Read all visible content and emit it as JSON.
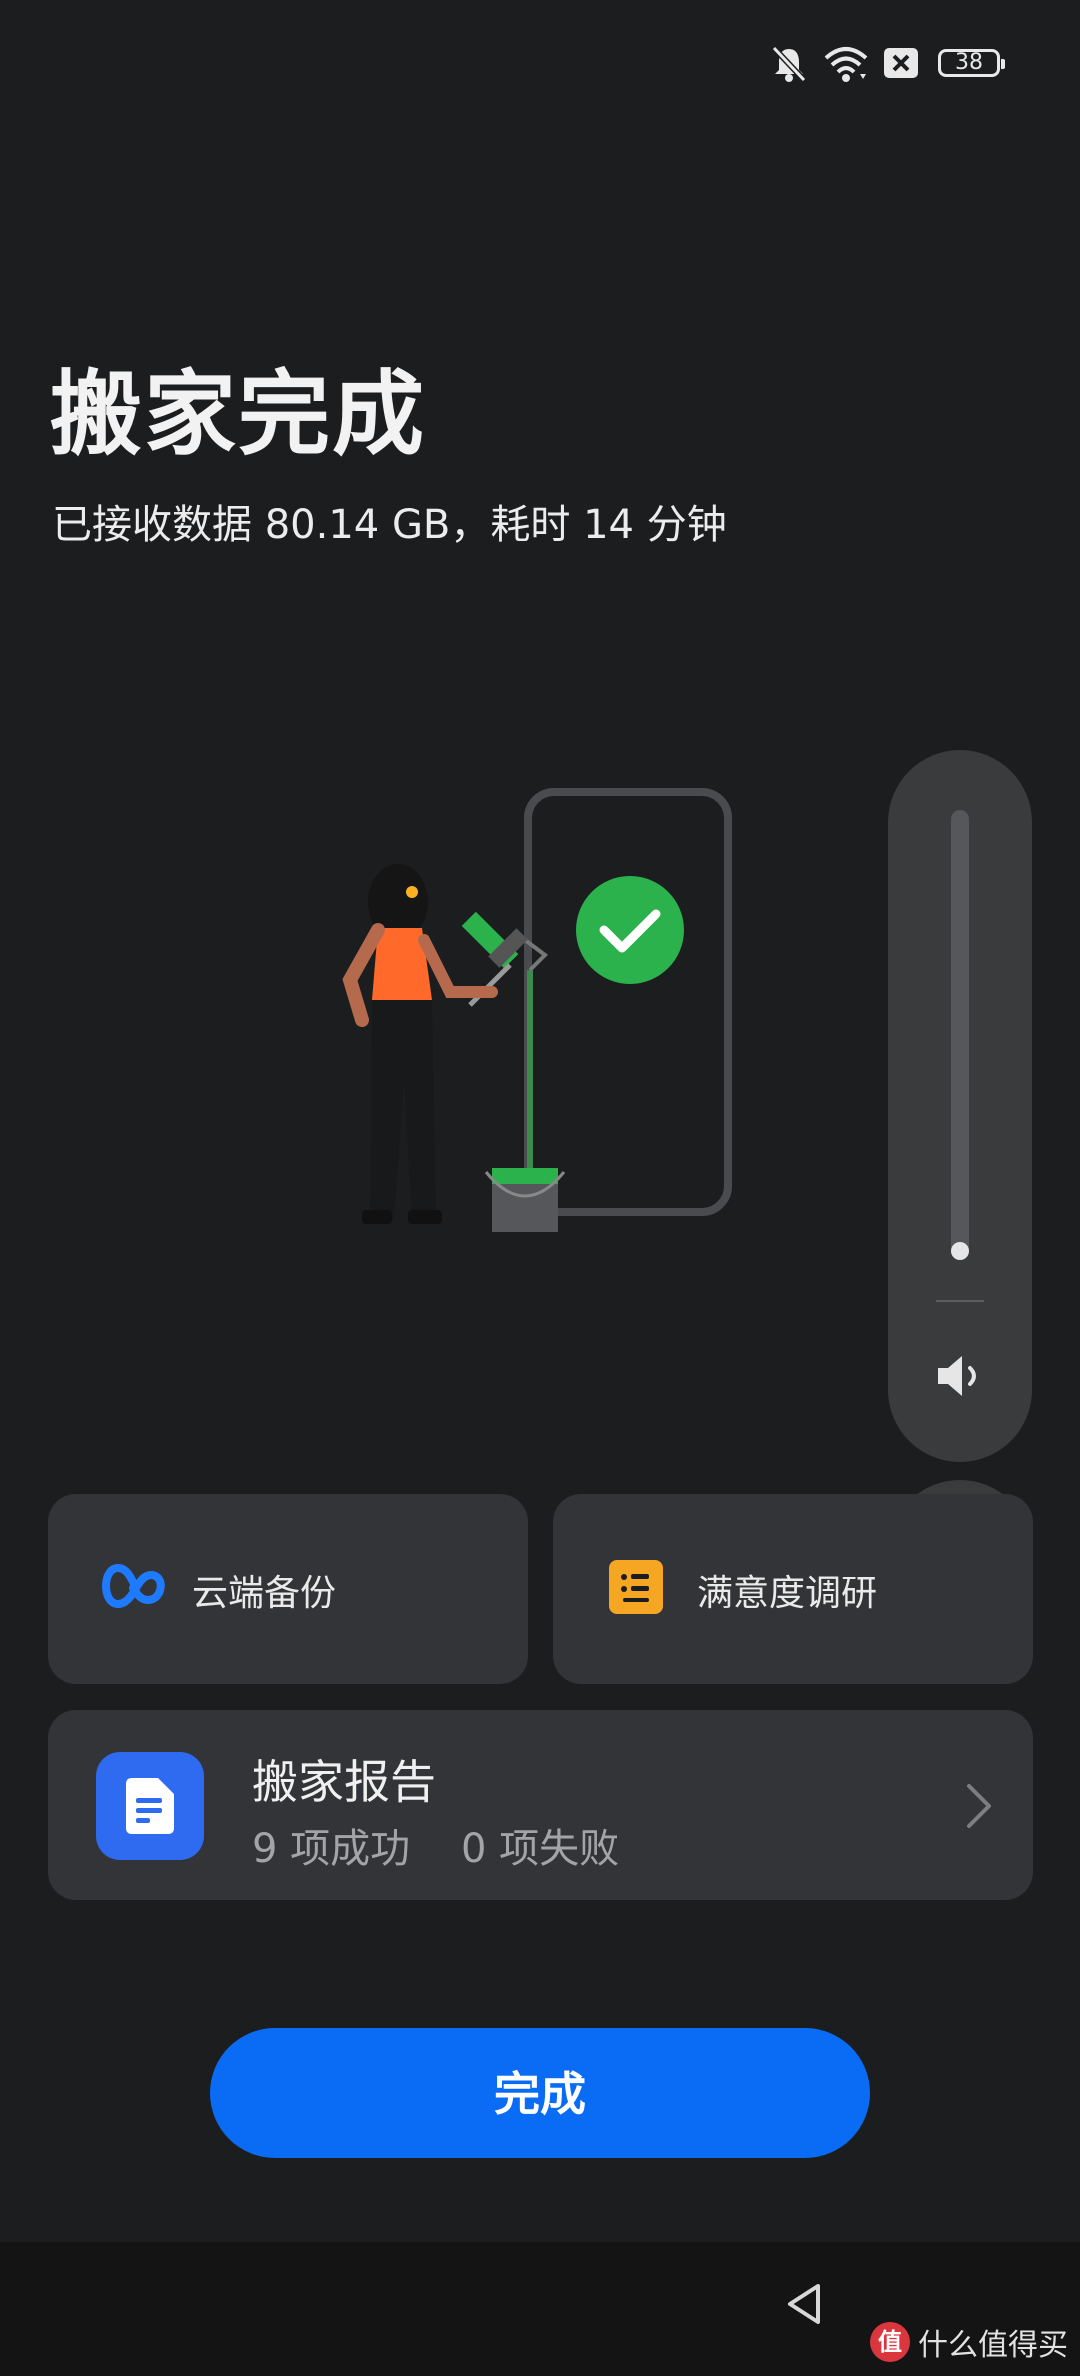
{
  "status_bar": {
    "icons": [
      "bell-muted-icon",
      "wifi-icon",
      "sim-no-signal-icon",
      "battery-icon"
    ],
    "battery_level": "38"
  },
  "header": {
    "title": "搬家完成",
    "subtitle": "已接收数据 80.14  GB，耗时 14 分钟"
  },
  "illustration": {
    "icon": "phone-paint-success-illustration",
    "accent_green": "#2bb24c",
    "accent_orange": "#ff6a2b"
  },
  "volume": {
    "level": 0.04,
    "icon": "speaker-icon",
    "more_icon": "more-vertical-icon"
  },
  "cards": {
    "cloud_backup": {
      "label": "云端备份",
      "icon": "cloud-infinity-icon",
      "icon_color": "#1e7bff"
    },
    "survey": {
      "label": "满意度调研",
      "icon": "list-icon",
      "icon_color": "#f5a623"
    },
    "report": {
      "title": "搬家报告",
      "stats": "9 项成功    0 项失败",
      "icon": "document-icon",
      "icon_color": "#2f6bf0",
      "chevron": "chevron-right-icon"
    }
  },
  "done_button": {
    "label": "完成"
  },
  "nav_bar": {
    "back_icon": "back-triangle-icon"
  },
  "watermark": {
    "logo": "值",
    "text": "什么值得买"
  },
  "colors": {
    "background": "#1c1d1f",
    "card": "#333437",
    "primary": "#0a6cf5"
  }
}
